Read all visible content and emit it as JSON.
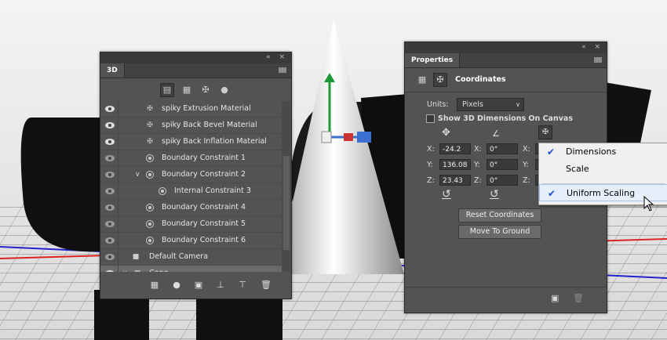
{
  "panel3d": {
    "tab": "3D",
    "window_buttons": "« ×",
    "filter_icons": [
      "whole-scene-icon",
      "meshes-icon",
      "materials-icon",
      "lights-icon"
    ],
    "layers": [
      {
        "label": "spiky Extrusion Material",
        "icon": "material-icon"
      },
      {
        "label": "spiky Back Bevel Material",
        "icon": "material-icon"
      },
      {
        "label": "spiky Back Inflation Material",
        "icon": "material-icon"
      },
      {
        "label": "Boundary Constraint 1",
        "icon": "constraint-icon"
      },
      {
        "label": "Boundary Constraint 2",
        "icon": "constraint-icon"
      },
      {
        "label": "Internal Constraint 3",
        "icon": "constraint-icon"
      },
      {
        "label": "Boundary Constraint 4",
        "icon": "constraint-icon"
      },
      {
        "label": "Boundary Constraint 5",
        "icon": "constraint-icon"
      },
      {
        "label": "Boundary Constraint 6",
        "icon": "constraint-icon"
      },
      {
        "label": "Default Camera",
        "icon": "camera-icon"
      },
      {
        "label": "Cone",
        "icon": "mesh-icon"
      }
    ],
    "bottom_icons": [
      "add-mesh-icon",
      "add-light-icon",
      "render-icon",
      "drop-to-ground-icon",
      "constraint-add-icon",
      "trash-icon"
    ]
  },
  "properties": {
    "tab": "Properties",
    "window_buttons": "« ×",
    "section": "Coordinates",
    "units_label": "Units:",
    "units_value": "Pixels",
    "show_dims_label": "Show 3D Dimensions On Canvas",
    "coords": {
      "x_label": "X:",
      "y_label": "Y:",
      "z_label": "Z:",
      "pos_x": "-24.2",
      "pos_y": "136.08",
      "pos_z": "23.43",
      "rot_x": "0°",
      "rot_y": "0°",
      "rot_z": "0°"
    },
    "reset_button": "Reset Coordinates",
    "ground_button": "Move To Ground"
  },
  "popup": {
    "items": [
      {
        "label": "Dimensions",
        "checked": true
      },
      {
        "label": "Scale",
        "checked": false
      },
      {
        "label": "Uniform Scaling",
        "checked": true
      }
    ],
    "check_glyph": "✔"
  },
  "colors": {
    "panel": "#535353",
    "panel_dark": "#3a3a3a",
    "accent_check": "#1a4fc9"
  }
}
